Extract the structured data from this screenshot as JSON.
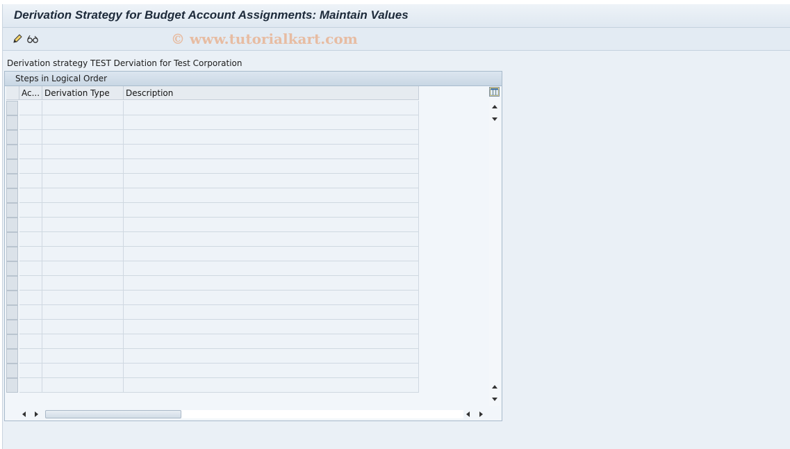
{
  "window": {
    "title": "Derivation Strategy for Budget Account Assignments: Maintain Values"
  },
  "toolbar": {
    "edit_icon": "pencil-icon",
    "display_change_icon": "glasses-icon",
    "watermark": "© www.tutorialkart.com"
  },
  "info": {
    "text": "Derivation strategy TEST Derviation for Test Corporation"
  },
  "table": {
    "section_title": "Steps in Logical Order",
    "columns": [
      "Ac...",
      "Derivation Type",
      "Description"
    ],
    "row_count": 21,
    "rows": [],
    "column_settings_icon": "table-settings-icon"
  }
}
